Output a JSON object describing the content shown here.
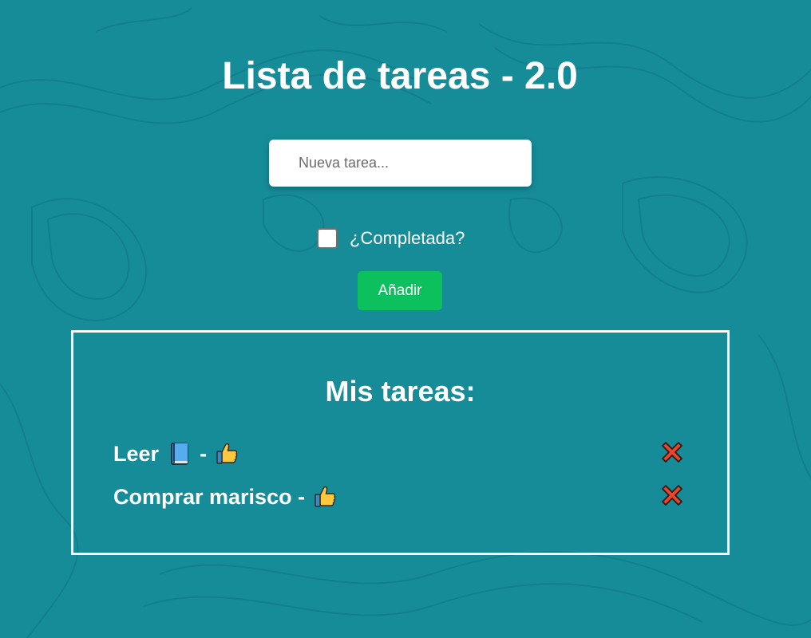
{
  "header": {
    "title": "Lista de tareas - 2.0"
  },
  "form": {
    "input_placeholder": "Nueva tarea...",
    "input_value": "",
    "checkbox_label": "¿Completada?",
    "checkbox_checked": false,
    "add_button_label": "Añadir"
  },
  "tasks": {
    "heading": "Mis tareas:",
    "items": [
      {
        "name": "Leer",
        "name_icon": "book-icon",
        "separator": "-",
        "status_icon": "thumbs-up-icon",
        "delete_icon": "cross-mark-icon"
      },
      {
        "name": "Comprar marisco",
        "separator": "-",
        "status_icon": "thumbs-up-icon",
        "delete_icon": "cross-mark-icon"
      }
    ]
  },
  "colors": {
    "background": "#168c99",
    "add_button": "#0cc05e",
    "delete_icon": "#e8452c",
    "text": "#ffffff"
  }
}
